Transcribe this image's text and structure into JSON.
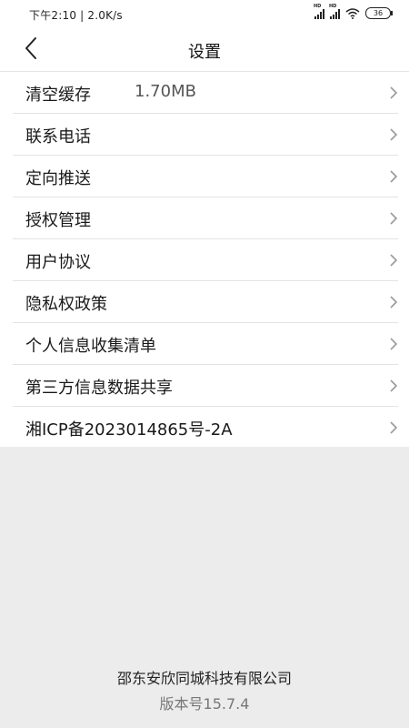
{
  "status": {
    "time_speed": "下午2:10 | 2.0K/s",
    "battery": "36",
    "signal_label": "HD"
  },
  "header": {
    "title": "设置"
  },
  "settings": [
    {
      "label": "清空缓存",
      "value": "1.70MB"
    },
    {
      "label": "联系电话"
    },
    {
      "label": "定向推送"
    },
    {
      "label": "授权管理"
    },
    {
      "label": "用户协议"
    },
    {
      "label": "隐私权政策"
    },
    {
      "label": "个人信息收集清单"
    },
    {
      "label": "第三方信息数据共享"
    },
    {
      "label": "湘ICP备2023014865号-2A"
    }
  ],
  "footer": {
    "company": "邵东安欣同城科技有限公司",
    "version": "版本号15.7.4"
  },
  "colors": {
    "page_background": "#ececec",
    "list_background": "#ffffff",
    "divider": "#e3e3e3",
    "chevron": "#9a9a9a"
  },
  "icons": [
    "back-arrow-icon",
    "chevron-right-icon",
    "signal-icon",
    "wifi-icon",
    "battery-icon"
  ]
}
